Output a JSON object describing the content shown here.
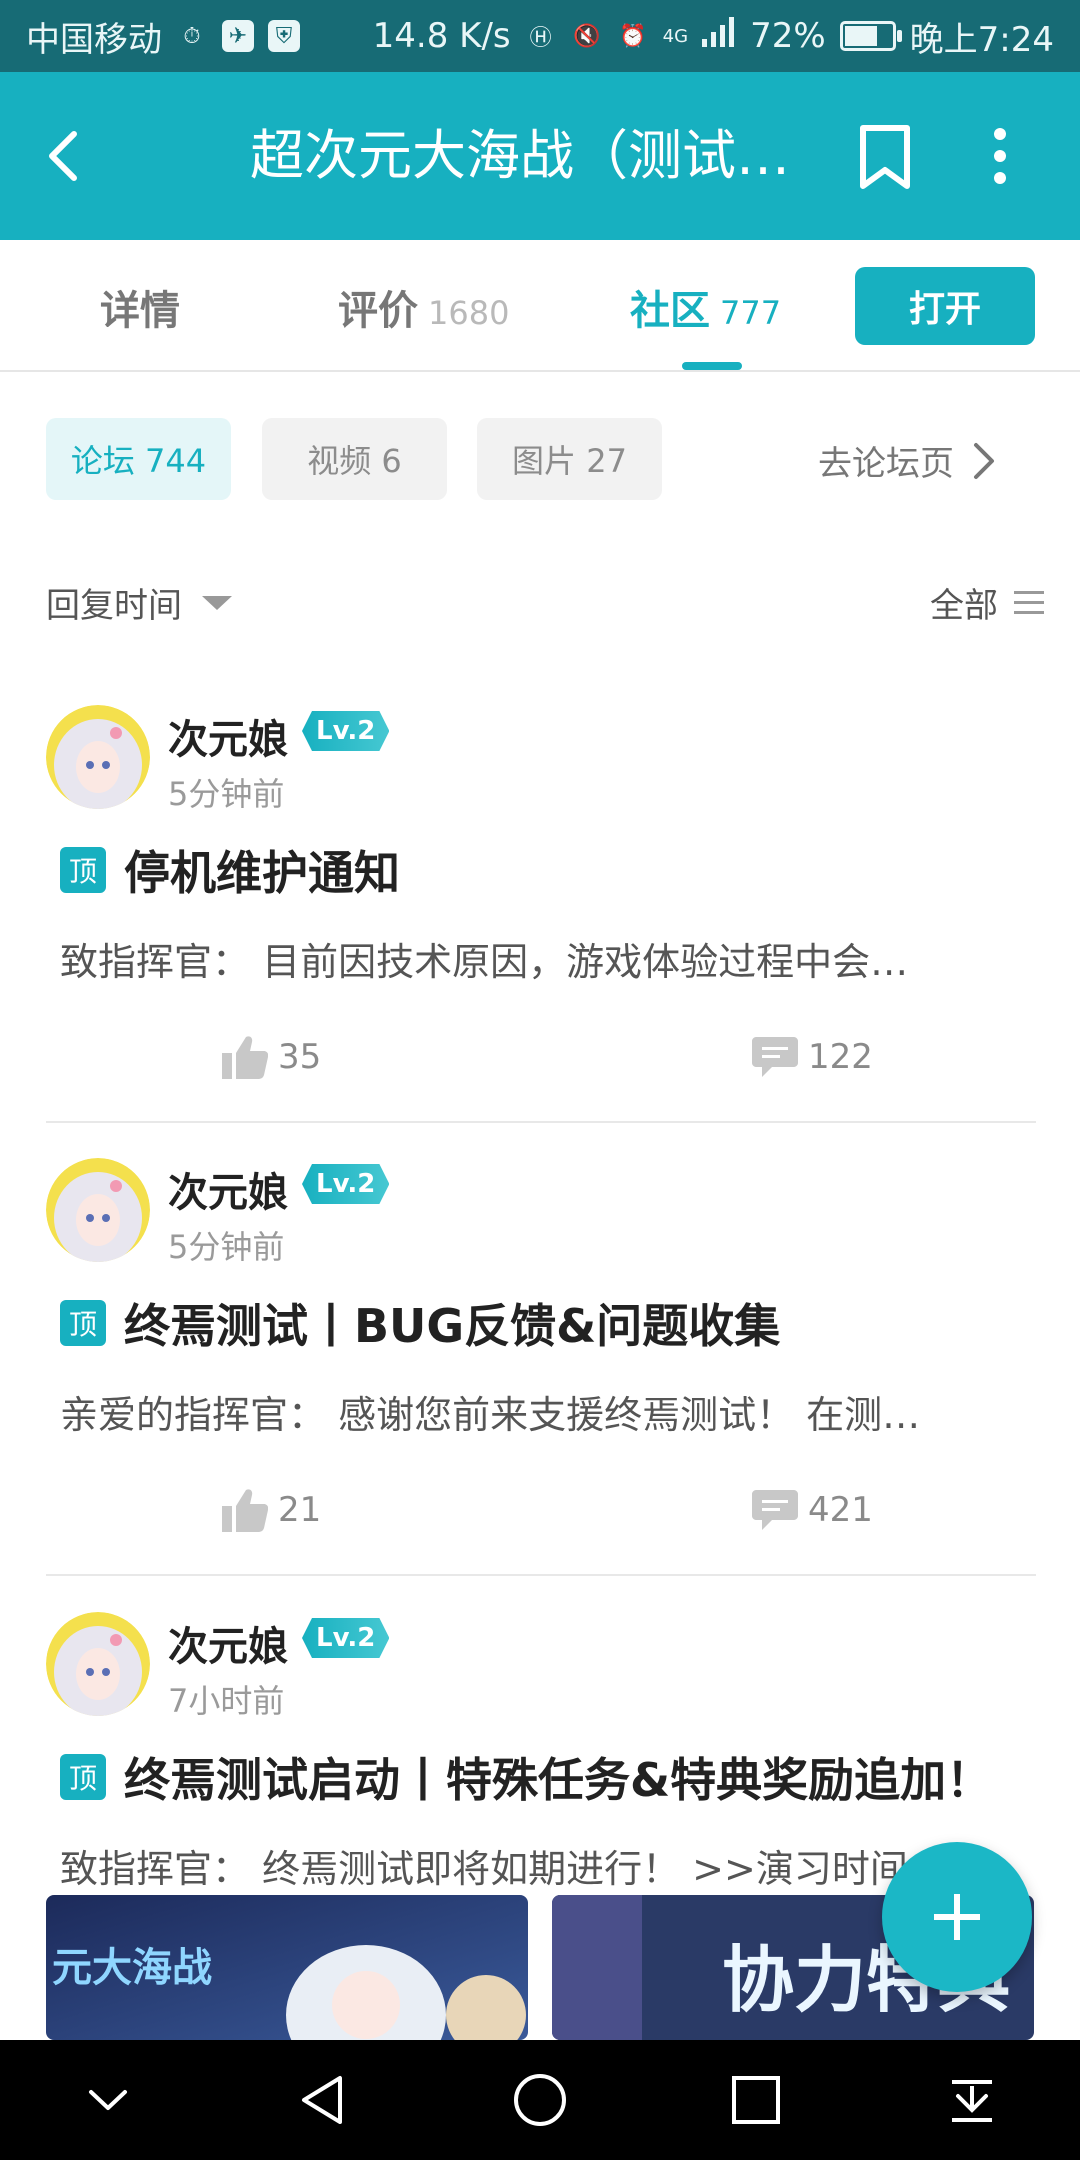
{
  "status_bar": {
    "carrier": "中国移动",
    "speed": "14.8 K/s",
    "network": "4G",
    "battery": "72%",
    "battery_level": 0.72,
    "time": "晚上7:24"
  },
  "app_bar": {
    "title": "超次元大海战（测试…"
  },
  "tabs": [
    {
      "label": "详情",
      "count": ""
    },
    {
      "label": "评价",
      "count": "1680"
    },
    {
      "label": "社区",
      "count": "777"
    }
  ],
  "open_button": "打开",
  "filters": [
    {
      "label": "论坛 744"
    },
    {
      "label": "视频 6"
    },
    {
      "label": "图片 27"
    }
  ],
  "goto_forum": "去论坛页",
  "sort_label": "回复时间",
  "filter_all": "全部",
  "posts": [
    {
      "user": "次元娘",
      "level": "Lv.2",
      "time": "5分钟前",
      "pin": "顶",
      "title": "停机维护通知",
      "excerpt": "致指挥官： 目前因技术原因，游戏体验过程中会…",
      "likes": "35",
      "comments": "122"
    },
    {
      "user": "次元娘",
      "level": "Lv.2",
      "time": "5分钟前",
      "pin": "顶",
      "title": "终焉测试丨BUG反馈&问题收集",
      "excerpt": "亲爱的指挥官： 感谢您前来支援终焉测试！ 在测…",
      "likes": "21",
      "comments": "421"
    },
    {
      "user": "次元娘",
      "level": "Lv.2",
      "time": "7小时前",
      "pin": "顶",
      "title": "终焉测试启动丨特殊任务&特典奖励追加！",
      "excerpt": "致指挥官： 终焉测试即将如期进行！ >>演习时间",
      "thumb_texts": [
        "元大海战",
        "协力特典"
      ]
    }
  ],
  "colors": {
    "primary": "#17b0c0",
    "status_bar": "#176b75"
  }
}
